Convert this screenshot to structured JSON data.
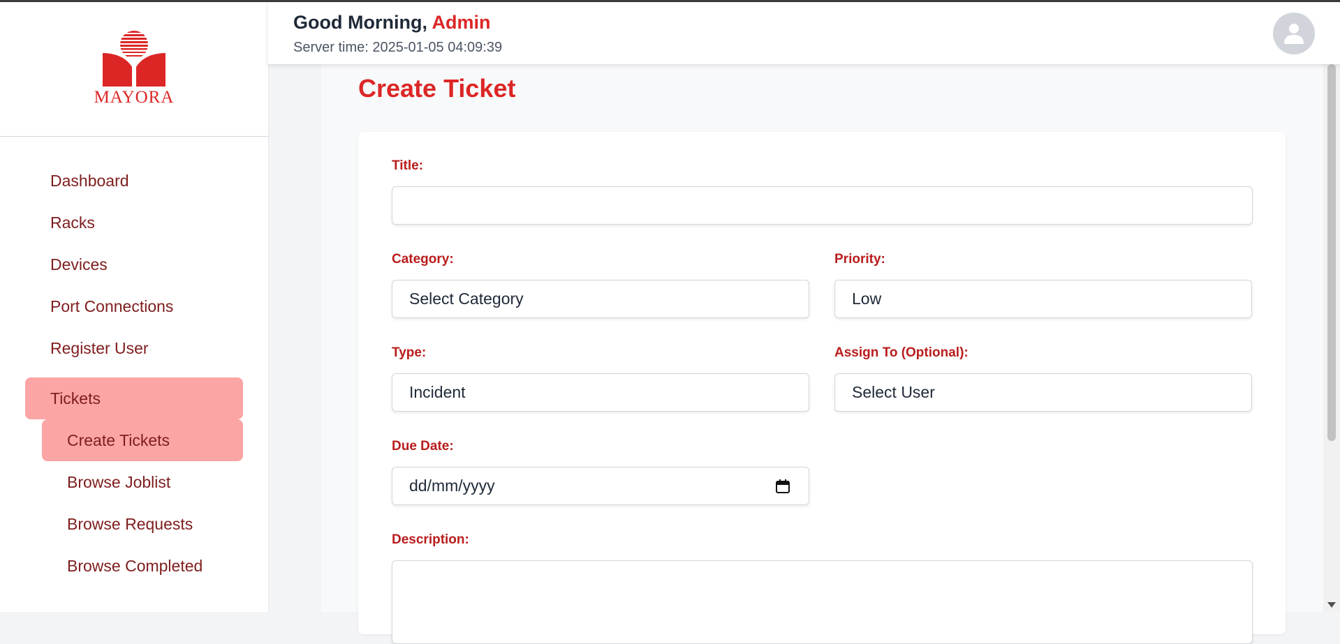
{
  "header": {
    "greeting": "Good Morning,",
    "user_name": "Admin",
    "server_time": "Server time: 2025-01-05 04:09:39"
  },
  "logo": {
    "text": "MAYORA",
    "color": "#dc2626"
  },
  "sidebar": {
    "items": [
      {
        "label": "Dashboard"
      },
      {
        "label": "Racks"
      },
      {
        "label": "Devices"
      },
      {
        "label": "Port Connections"
      },
      {
        "label": "Register User"
      },
      {
        "label": "Tickets",
        "active": true
      },
      {
        "label": "Create Tickets",
        "active": true
      },
      {
        "label": "Browse Joblist"
      },
      {
        "label": "Browse Requests"
      },
      {
        "label": "Browse Completed"
      }
    ]
  },
  "main": {
    "title": "Create Ticket",
    "form": {
      "title_label": "Title:",
      "title_value": "",
      "category_label": "Category:",
      "category_value": "Select Category",
      "priority_label": "Priority:",
      "priority_value": "Low",
      "type_label": "Type:",
      "type_value": "Incident",
      "assign_label": "Assign To (Optional):",
      "assign_value": "Select User",
      "due_label": "Due Date:",
      "due_value": "dd/mm/yyyy",
      "description_label": "Description:",
      "description_value": ""
    }
  },
  "colors": {
    "accent": "#dc2626",
    "label": "#b91c1c",
    "nav_text": "#7f1d1d",
    "active_bg": "#fca5a5"
  },
  "icons": {
    "avatar": "user-icon",
    "date": "calendar-icon"
  }
}
